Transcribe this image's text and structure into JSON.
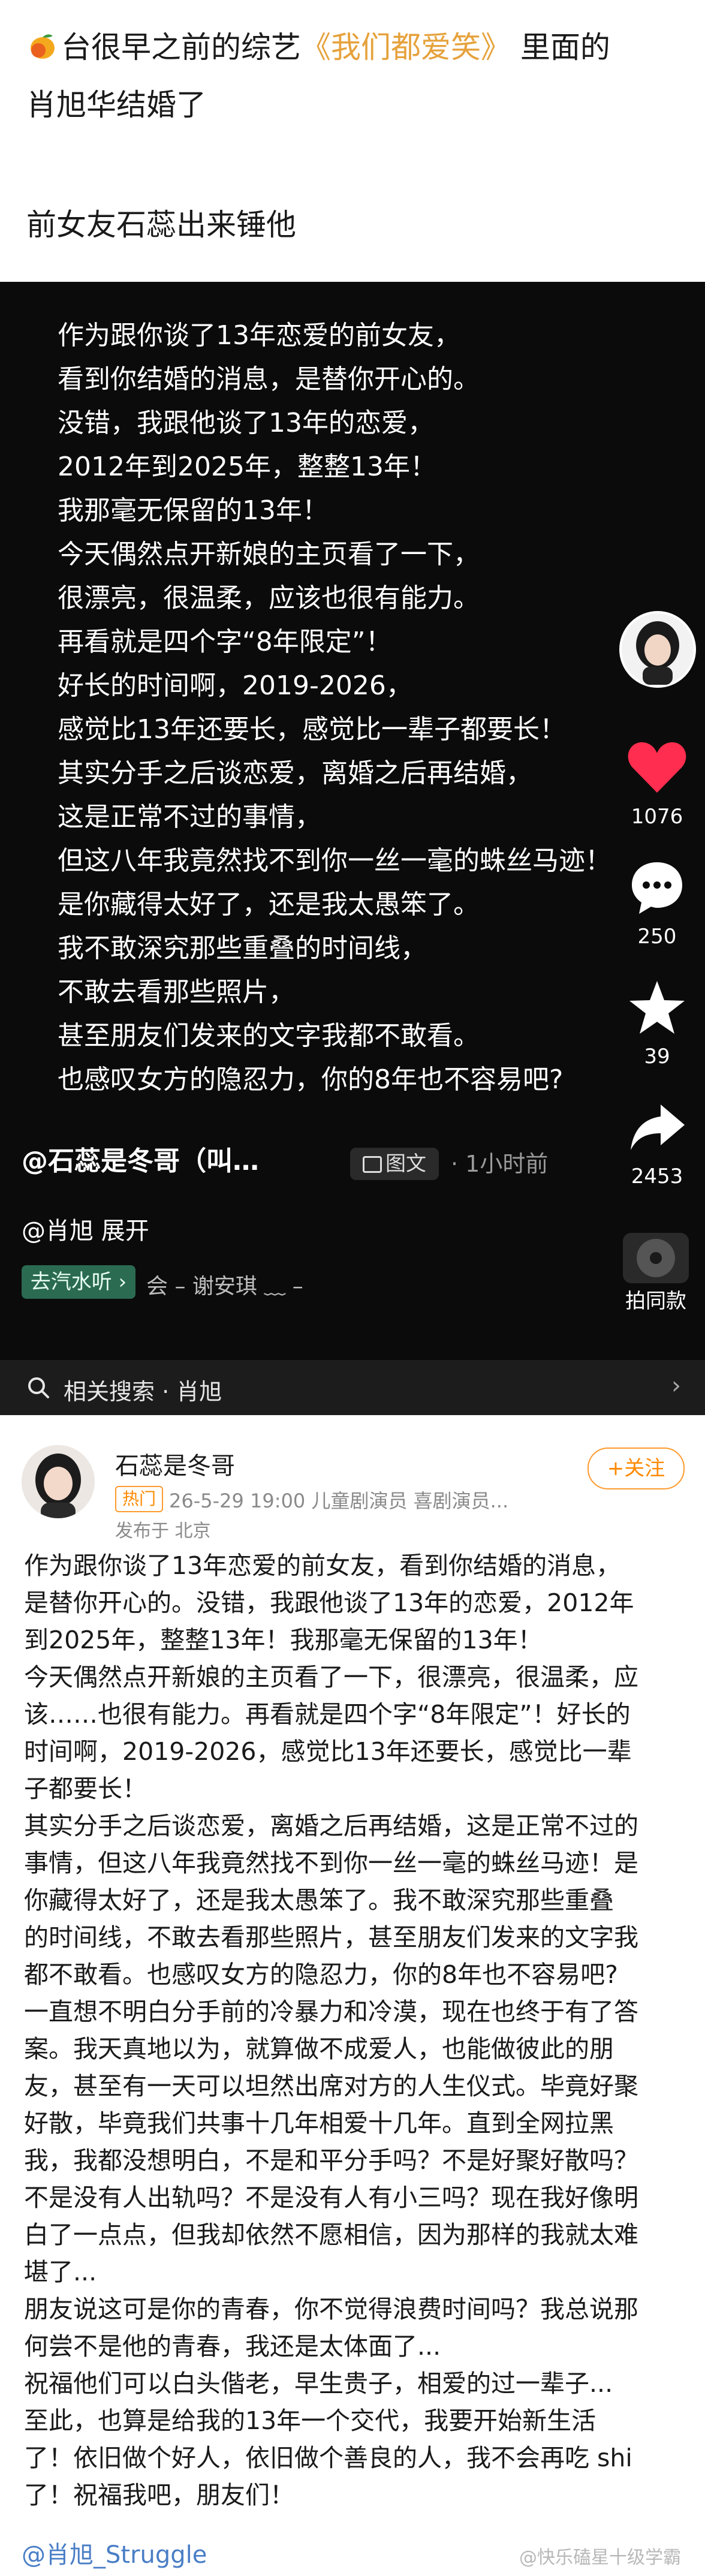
{
  "caption": {
    "line1_prefix": "台很早之前的综艺",
    "line1_show": "《我们都爱笑》",
    "line1_suffix": " 里面的",
    "line2": "肖旭华结婚了",
    "line3": "前女友石蕊出来锤他"
  },
  "video": {
    "lines": [
      "作为跟你谈了13年恋爱的前女友，",
      "看到你结婚的消息，是替你开心的。",
      "没错，我跟他谈了13年的恋爱，",
      "2012年到2025年，整整13年！",
      "我那毫无保留的13年！",
      "今天偶然点开新娘的主页看了一下，",
      "很漂亮，很温柔，应该也很有能力。",
      "再看就是四个字“8年限定”！",
      "好长的时间啊，2019-2026，",
      "感觉比13年还要长，感觉比一辈子都要长！",
      "其实分手之后谈恋爱，离婚之后再结婚，",
      "这是正常不过的事情，",
      "但这八年我竟然找不到你一丝一毫的蛛丝马迹！",
      "是你藏得太好了，还是我太愚笨了。",
      "我不敢深究那些重叠的时间线，",
      "不敢去看那些照片，",
      "甚至朋友们发来的文字我都不敢看。",
      "也感叹女方的隐忍力，你的8年也不容易吧?"
    ],
    "likes": "1076",
    "comments": "250",
    "favorites": "39",
    "shares": "2453",
    "author": "@石蕊是冬哥（叫…",
    "tag": "图文",
    "time": "· 1小时前",
    "desc": "@肖旭  展开",
    "music_pill": "去汽水听 ›",
    "music_text": "会 – 谢安琪    ﹏ –",
    "same_style": "拍同款",
    "related": "相关搜索 · 肖旭"
  },
  "post": {
    "name": "石蕊是冬哥",
    "hot": "热门",
    "meta": "26-5-29 19:00  儿童剧演员 喜剧演员...",
    "location": "发布于 北京",
    "follow": "+关注",
    "lines": [
      "作为跟你谈了13年恋爱的前女友，看到你结婚的消息，",
      "是替你开心的。没错，我跟他谈了13年的恋爱，2012年",
      "到2025年，整整13年！我那毫无保留的13年！",
      "今天偶然点开新娘的主页看了一下，很漂亮，很温柔，应",
      "该……也很有能力。再看就是四个字“8年限定”！好长的",
      "时间啊，2019-2026，感觉比13年还要长，感觉比一辈",
      "子都要长！",
      "其实分手之后谈恋爱，离婚之后再结婚，这是正常不过的",
      "事情，但这八年我竟然找不到你一丝一毫的蛛丝马迹！是",
      "你藏得太好了，还是我太愚笨了。我不敢深究那些重叠",
      "的时间线，不敢去看那些照片，甚至朋友们发来的文字我",
      "都不敢看。也感叹女方的隐忍力，你的8年也不容易吧?",
      "一直想不明白分手前的冷暴力和冷漠，现在也终于有了答",
      "案。我天真地以为，就算做不成爱人，也能做彼此的朋",
      "友，甚至有一天可以坦然出席对方的人生仪式。毕竟好聚",
      "好散，毕竟我们共事十几年相爱十几年。直到全网拉黑",
      "我，我都没想明白，不是和平分手吗？不是好聚好散吗？",
      "不是没有人出轨吗？不是没有人有小三吗？现在我好像明",
      "白了一点点，但我却依然不愿相信，因为那样的我就太难",
      "堪了...",
      "朋友说这可是你的青春，你不觉得浪费时间吗？我总说那",
      "何尝不是他的青春，我还是太体面了...",
      "祝福他们可以白头偕老，早生贵子，相爱的过一辈子...",
      "至此，也算是给我的13年一个交代，我要开始新生活",
      "了！依旧做个好人，依旧做个善良的人，我不会再吃 shi",
      "了！祝福我吧，朋友们！"
    ],
    "footer_tag": "@肖旭_Struggle",
    "watermark": "@快乐磕星十级学霸"
  }
}
